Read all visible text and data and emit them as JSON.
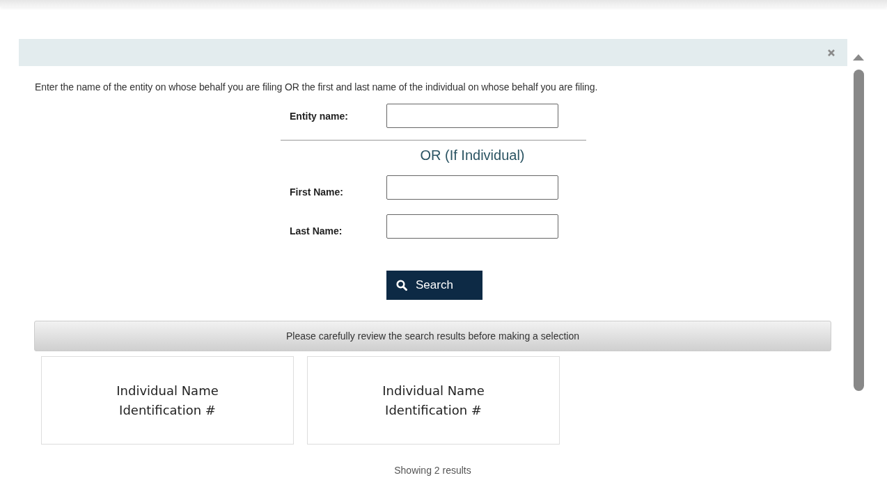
{
  "dialog": {
    "instructions": "Enter the name of the entity on whose behalf you are filing OR the first and last name of the individual on whose behalf you are filing."
  },
  "form": {
    "entity_field": {
      "label": "Entity name:"
    },
    "separator": "OR (If Individual)",
    "individual_fields": [
      {
        "label": "First Name:"
      },
      {
        "label": "Last Name:"
      }
    ],
    "search_button": "Search"
  },
  "results": {
    "banner": "Please carefully review the search results before making a selection",
    "cards": [
      {
        "name": "Individual Name",
        "identification": "Identification #"
      },
      {
        "name": "Individual Name",
        "identification": "Identification #"
      }
    ],
    "count": "Showing 2 results"
  }
}
